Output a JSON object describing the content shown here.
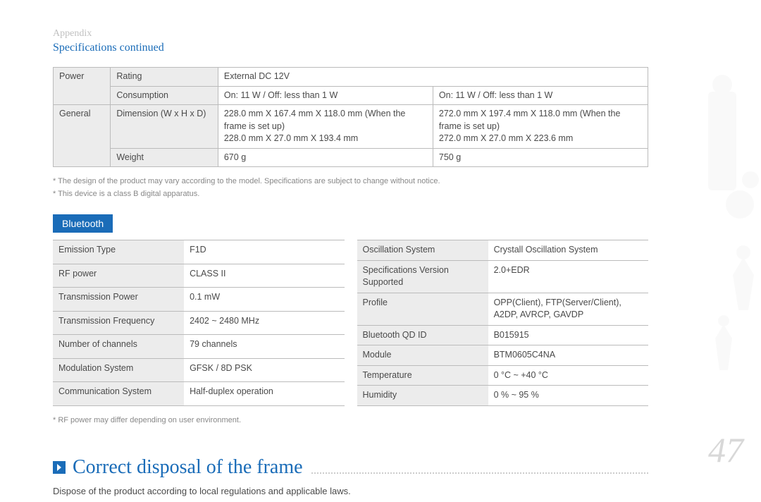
{
  "header": {
    "appendix": "Appendix",
    "subtitle": "Specifications continued"
  },
  "spec_table": {
    "power": {
      "label": "Power",
      "rating_k": "Rating",
      "rating_v": "External DC 12V",
      "consumption_k": "Consumption",
      "consumption_v1": "On: 11 W / Off: less than 1 W",
      "consumption_v2": "On: 11 W / Off: less than 1 W"
    },
    "general": {
      "label": "General",
      "dim_k": "Dimension (W x H x D)",
      "dim_v1": "228.0 mm X 167.4 mm X 118.0 mm (When the frame is set up)\n228.0 mm X 27.0 mm X 193.4 mm",
      "dim_v2": "272.0 mm X 197.4 mm X 118.0 mm (When the frame is set up)\n272.0 mm X 27.0 mm X 223.6 mm",
      "weight_k": "Weight",
      "weight_v1": "670 g",
      "weight_v2": "750 g"
    }
  },
  "spec_notes": {
    "n1": "* The design of the product may vary according to the model. Specifications are subject to change without notice.",
    "n2": "* This device is a class B digital apparatus."
  },
  "bluetooth_label": "Bluetooth",
  "bt_left": [
    {
      "k": "Emission Type",
      "v": "F1D"
    },
    {
      "k": "RF power",
      "v": "CLASS II"
    },
    {
      "k": "Transmission Power",
      "v": "0.1 mW"
    },
    {
      "k": "Transmission Frequency",
      "v": "2402 ~ 2480 MHz"
    },
    {
      "k": "Number of channels",
      "v": "79 channels"
    },
    {
      "k": "Modulation System",
      "v": "GFSK / 8D PSK"
    },
    {
      "k": "Communication System",
      "v": "Half-duplex operation"
    }
  ],
  "bt_right": [
    {
      "k": "Oscillation System",
      "v": "Crystall Oscillation System"
    },
    {
      "k": "Specifications Version Supported",
      "v": "2.0+EDR"
    },
    {
      "k": "Profile",
      "v": "OPP(Client), FTP(Server/Client), A2DP, AVRCP, GAVDP"
    },
    {
      "k": "Bluetooth QD ID",
      "v": "B015915"
    },
    {
      "k": "Module",
      "v": "BTM0605C4NA"
    },
    {
      "k": "Temperature",
      "v": "0 °C ~ +40 °C"
    },
    {
      "k": "Humidity",
      "v": "0 % ~ 95 %"
    }
  ],
  "bt_note": "* RF power may differ depending on user environment.",
  "disposal": {
    "heading": "Correct disposal of the frame",
    "text": "Dispose of the product according to local regulations and applicable laws."
  },
  "page_number": "47"
}
